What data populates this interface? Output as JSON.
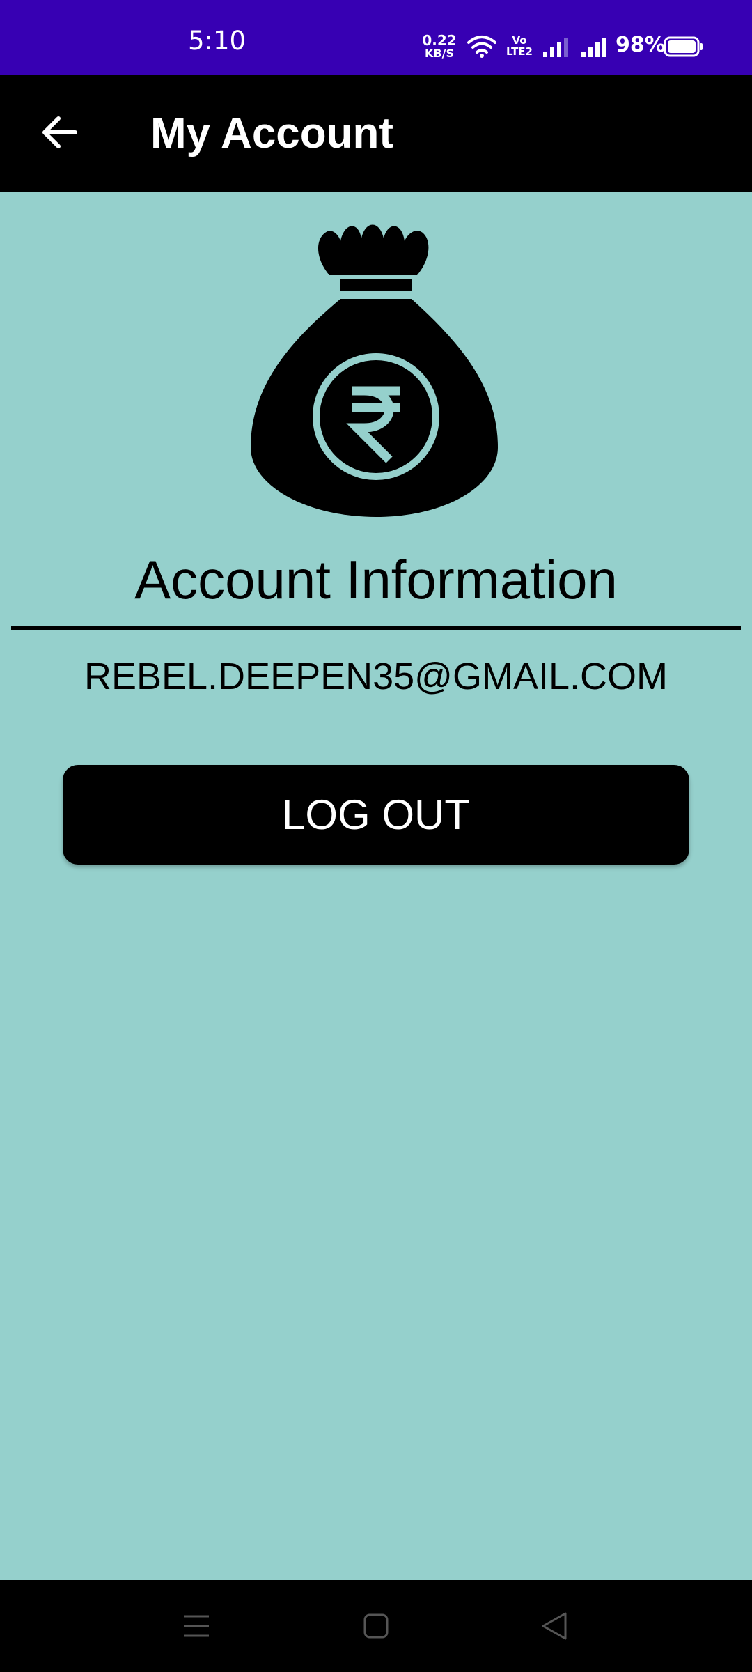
{
  "status_bar": {
    "time": "5:10",
    "net_speed_value": "0.22",
    "net_speed_unit": "KB/S",
    "volte_top": "Vo",
    "volte_bottom": "LTE2",
    "battery_percent": "98%",
    "icons": [
      "wifi-icon",
      "volte-icon",
      "signal-icon",
      "signal-icon",
      "battery-icon"
    ]
  },
  "app_bar": {
    "title": "My Account",
    "back_icon": "arrow-left-icon"
  },
  "content": {
    "hero_icon": "rupee-money-bag-icon",
    "section_title": "Account Information",
    "email": "REBEL.DEEPEN35@GMAIL.COM",
    "logout_label": "LOG OUT"
  },
  "nav_bar": {
    "icons": [
      "menu-icon",
      "home-square-icon",
      "back-triangle-icon"
    ]
  },
  "colors": {
    "status_bar_bg": "#3700b3",
    "app_bar_bg": "#000000",
    "page_bg": "#95d0cc",
    "button_bg": "#000000",
    "button_text": "#ffffff",
    "text": "#000000"
  }
}
